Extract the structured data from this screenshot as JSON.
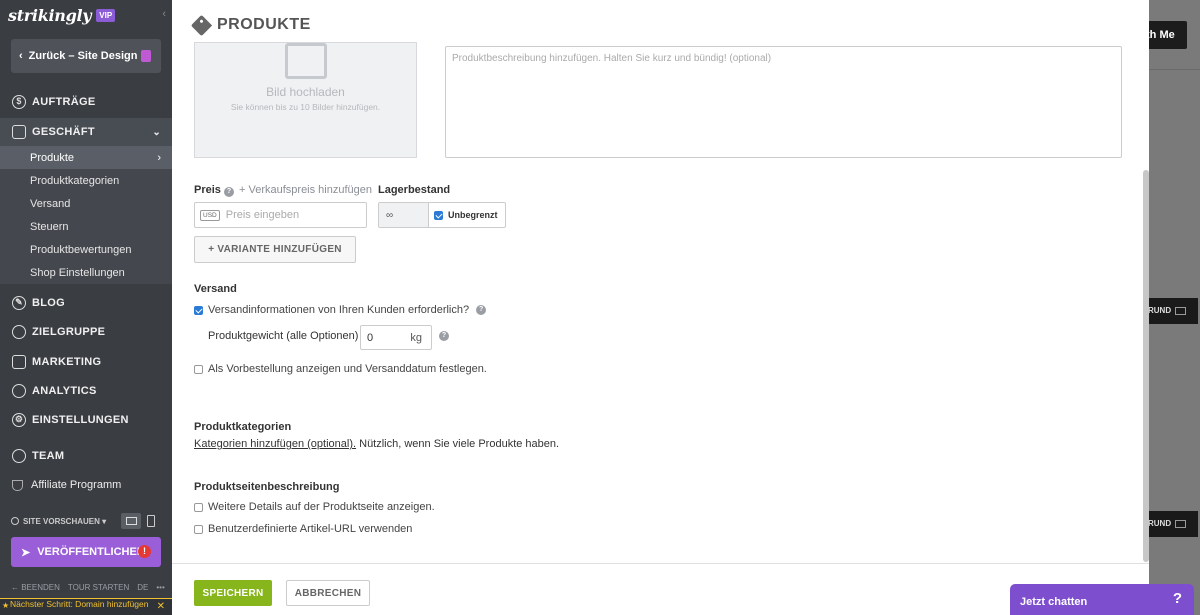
{
  "sidebar": {
    "logo": "strikingly",
    "vip": "VIP",
    "collapse": "‹",
    "back_label": "Zurück – Site Design",
    "nav": {
      "orders": "AUFTRÄGE",
      "business": "GESCHÄFT",
      "blog": "BLOG",
      "audience": "ZIELGRUPPE",
      "marketing": "MARKETING",
      "analytics": "ANALYTICS",
      "settings": "EINSTELLUNGEN",
      "team": "TEAM",
      "affiliate": "Affiliate Programm"
    },
    "business_sub": [
      "Produkte",
      "Produktkategorien",
      "Versand",
      "Steuern",
      "Produktbewertungen",
      "Shop Einstellungen"
    ],
    "preview_label": "SITE VORSCHAUEN",
    "publish_label": "VERÖFFENTLICHEN",
    "publish_alert": "!",
    "bottom": {
      "quit": "← BEENDEN",
      "tour": "TOUR STARTEN",
      "lang": "DE",
      "more": "•••"
    },
    "next_step": "Nächster Schritt: Domain hinzufügen"
  },
  "modal": {
    "title": "PRODUKTE",
    "upload_title": "Bild hochladen",
    "upload_sub": "Sie können bis zu 10 Bilder hinzufügen.",
    "description_placeholder": "Produktbeschreibung hinzufügen. Halten Sie kurz und bündig! (optional)",
    "price_label": "Preis",
    "add_sale_price": "+ Verkaufspreis hinzufügen",
    "stock_label": "Lagerbestand",
    "currency": "USD",
    "price_placeholder": "Preis eingeben",
    "stock_value": "∞",
    "unlimited_label": "Unbegrenzt",
    "variant_btn": "+ VARIANTE HINZUFÜGEN",
    "shipping_title": "Versand",
    "shipping_required": "Versandinformationen von Ihren Kunden erforderlich?",
    "weight_label": "Produktgewicht (alle Optionen)",
    "weight_value": "0",
    "weight_unit": "kg",
    "preorder": "Als Vorbestellung anzeigen und Versanddatum festlegen.",
    "categories_title": "Produktkategorien",
    "categories_link": "Kategorien hinzufügen (optional).",
    "categories_hint": " Nützlich, wenn Sie viele Produkte haben.",
    "page_desc_title": "Produktseitenbeschreibung",
    "more_details": "Weitere Details auf der Produktseite anzeigen.",
    "custom_url": "Benutzerdefinierte Artikel-URL verwenden",
    "save": "SPEICHERN",
    "cancel": "ABBRECHEN"
  },
  "background": {
    "with_me": "th Me",
    "grund_btn": "RUND"
  },
  "chat": {
    "label": "Jetzt chatten",
    "icon": "?"
  },
  "colors": {
    "accent": "#86b51c",
    "brand_purple": "#9b5ed9",
    "sidebar_bg": "#3a3d42"
  }
}
